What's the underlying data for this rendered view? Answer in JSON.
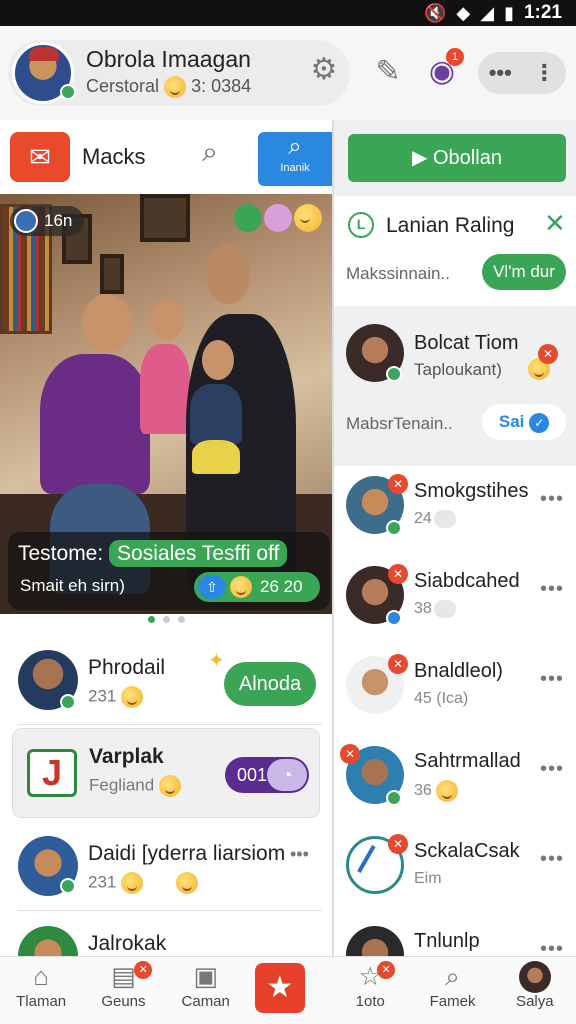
{
  "status_bar": {
    "time": "1:21"
  },
  "header": {
    "profile_name": "Obrola Imaagan",
    "profile_sub": "Cerstoral",
    "profile_sub_value": "3: 0384",
    "badge_count": "1"
  },
  "left_tabs": {
    "tab_label": "Macks",
    "active_tab_label": "Inanik"
  },
  "hero": {
    "chip": "16n",
    "caption_lead": "Testome:",
    "caption_highlight": "Sosiales Tesffi off",
    "caption_sub": "Smait eh sirn)",
    "pill_value": "26 20"
  },
  "feed": [
    {
      "name": "Phrodail",
      "sub": "231",
      "action": "Alnoda"
    },
    {
      "name": "Varplak",
      "sub": "Fegliand",
      "toggle_value": "001"
    },
    {
      "name": "Daidi [yderra liarsiom",
      "sub": "231"
    },
    {
      "name": "Jalrokak",
      "sub": ""
    }
  ],
  "right_panel": {
    "primary_button": "Obollan",
    "card_title": "Lanian Raling",
    "card_sub": "Makssinnain..",
    "card_button": "Vl'm dur",
    "feature_name": "Bolcat Tiom",
    "feature_sub": "Taploukant)",
    "feature_row_sub": "MabsrTenain..",
    "feature_button": "Sai",
    "contacts": [
      {
        "name": "Smokgstihes",
        "sub": "24"
      },
      {
        "name": "Siabdcahed",
        "sub": "38"
      },
      {
        "name": "Bnaldleol)",
        "sub": "45 (Ica)"
      },
      {
        "name": "Sahtrmallad",
        "sub": "36"
      },
      {
        "name": "SckalaCsak",
        "sub": "Eim"
      },
      {
        "name": "Tnlunlp",
        "sub": ""
      }
    ]
  },
  "bottom_nav": [
    {
      "label": "Tlaman",
      "icon": "home-icon"
    },
    {
      "label": "Geuns",
      "icon": "chart-icon"
    },
    {
      "label": "Caman",
      "icon": "camera-icon"
    },
    {
      "label": "",
      "icon": "star-icon"
    },
    {
      "label": "1oto",
      "icon": "badge-star-icon"
    },
    {
      "label": "Famek",
      "icon": "search-icon"
    },
    {
      "label": "Salya",
      "icon": "profile-avatar"
    }
  ],
  "colors": {
    "accent_green": "#3aa655",
    "accent_blue": "#2b88e0",
    "accent_red": "#e6492d",
    "accent_purple": "#5b2c8f"
  }
}
